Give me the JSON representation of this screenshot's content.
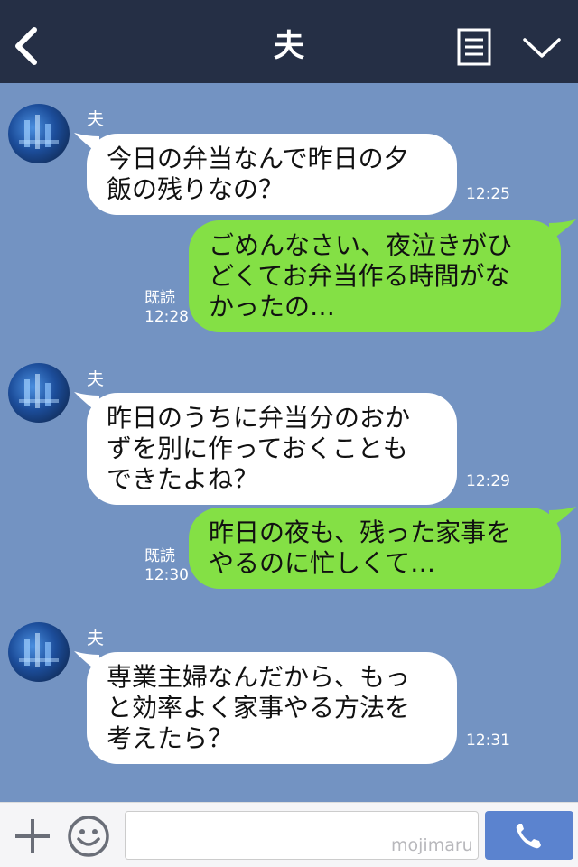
{
  "header": {
    "title": "夫",
    "back_icon": "chevron-left-icon",
    "menu_icon": "notes-icon",
    "down_icon": "chevron-down-icon",
    "background": "#252f45"
  },
  "messages": [
    {
      "direction": "incoming",
      "sender": "夫",
      "text": "今日の弁当なんで昨日の夕\n飯の残りなの？",
      "time": "12:25"
    },
    {
      "direction": "outgoing",
      "text": "ごめんなさい、夜泣きがひ\nどくてお弁当作る時間がな\nかったの…",
      "read": "既読",
      "time": "12:28"
    },
    {
      "direction": "incoming",
      "sender": "夫",
      "text": "昨日のうちに弁当分のおか\nずを別に作っておくことも\nできたよね？",
      "time": "12:29"
    },
    {
      "direction": "outgoing",
      "text": "昨日の夜も、残った家事を\nやるのに忙しくて…",
      "read": "既読",
      "time": "12:30"
    },
    {
      "direction": "incoming",
      "sender": "夫",
      "text": "専業主婦なんだから、もっ\nと効率よく家事やる方法を\n考えたら？",
      "time": "12:31"
    }
  ],
  "footer": {
    "input_placeholder": "",
    "watermark": "mojimaru",
    "plus_icon": "plus-icon",
    "emoji_icon": "smiley-icon",
    "call_icon": "phone-icon"
  },
  "colors": {
    "chat_background": "#7393c2",
    "outgoing_bubble": "#84e045",
    "incoming_bubble": "#ffffff",
    "call_button": "#5b83cf"
  }
}
